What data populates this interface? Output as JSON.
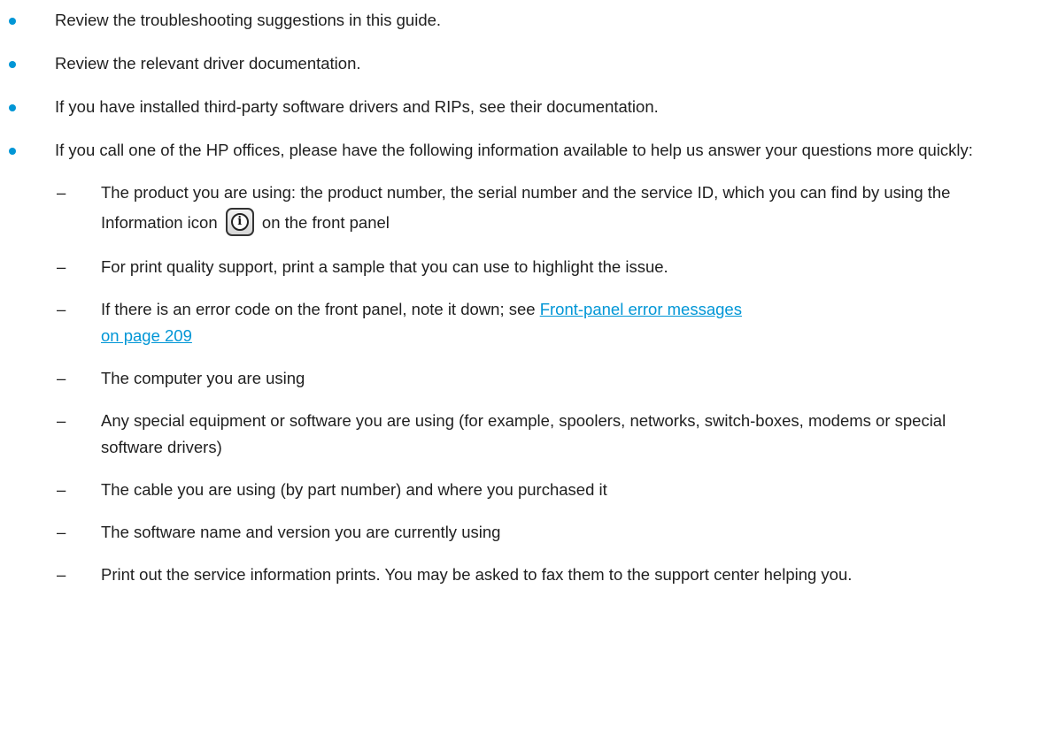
{
  "bullets": [
    {
      "text": "Review the troubleshooting suggestions in this guide."
    },
    {
      "text": "Review the relevant driver documentation."
    },
    {
      "text": "If you have installed third-party software drivers and RIPs, see their documentation."
    },
    {
      "text": "If you call one of the HP offices, please have the following information available to help us answer your questions more quickly:",
      "sub": [
        {
          "before_icon": "The product you are using: the product number, the serial number and the service ID, which you can find by using the Information icon",
          "after_icon": "on the front panel",
          "icon": "information-icon",
          "icon_glyph": "i"
        },
        {
          "text": "For print quality support, print a sample that you can use to highlight the issue."
        },
        {
          "before_link": "If there is an error code on the front panel, note it down; see ",
          "link_line1": "Front-panel error messages",
          "link_line2": "on page 209"
        },
        {
          "text": "The computer you are using"
        },
        {
          "text": "Any special equipment or software you are using (for example, spoolers, networks, switch-boxes, modems or special software drivers)"
        },
        {
          "text": "The cable you are using (by part number) and where you purchased it"
        },
        {
          "text": "The software name and version you are currently using"
        },
        {
          "text": "Print out the service information prints. You may be asked to fax them to the support center helping you."
        }
      ]
    }
  ],
  "dash_glyph": "–",
  "colors": {
    "bullet": "#0096d6",
    "link": "#0096d6",
    "text": "#1f1f1f"
  }
}
